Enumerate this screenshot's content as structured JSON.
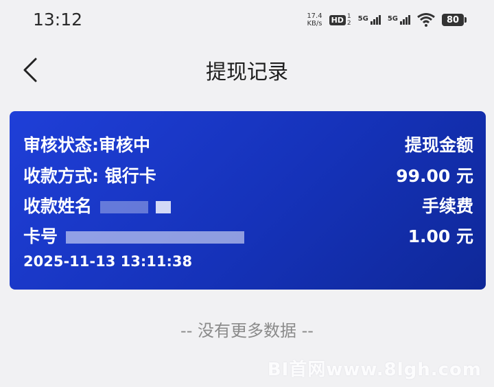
{
  "status_bar": {
    "time": "13:12",
    "net_speed_value": "17.4",
    "net_speed_unit": "KB/s",
    "hd_label": "HD",
    "hd_sub_top": "1",
    "hd_sub_bottom": "2",
    "sim1_label": "5G",
    "sim2_label": "5G",
    "battery": "80"
  },
  "header": {
    "back_icon": "chevron-left-icon",
    "title": "提现记录"
  },
  "record": {
    "status_label": "审核状态:审核中",
    "amount_label": "提现金额",
    "method_label": "收款方式: 银行卡",
    "amount_value": "99.00 元",
    "name_label": "收款姓名",
    "fee_label": "手续费",
    "card_label": "卡号",
    "fee_value": "1.00 元",
    "datetime": "2025-11-13 13:11:38"
  },
  "footer": {
    "no_more": "-- 没有更多数据 --",
    "watermark": "BI首网www.8lgh.com"
  },
  "colors": {
    "card_start": "#1f3fd8",
    "card_end": "#0f2898",
    "background": "#f1f1f3"
  }
}
